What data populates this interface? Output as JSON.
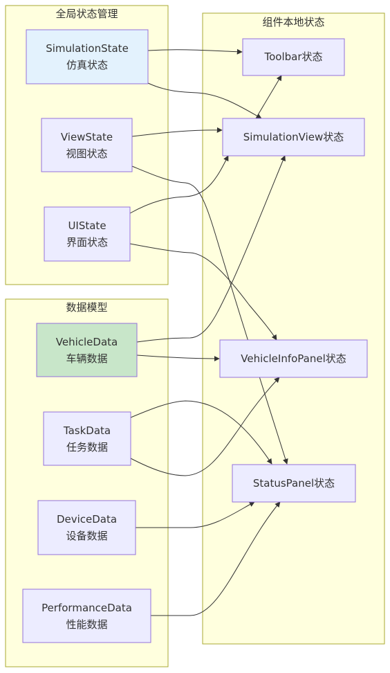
{
  "clusters": {
    "global": {
      "title": "全局状态管理"
    },
    "data": {
      "title": "数据模型"
    },
    "local": {
      "title": "组件本地状态"
    }
  },
  "nodes": {
    "simstate": {
      "line1": "SimulationState",
      "line2": "仿真状态",
      "fill": "#e3f2fd"
    },
    "viewstate": {
      "line1": "ViewState",
      "line2": "视图状态",
      "fill": "#ececff"
    },
    "uistate": {
      "line1": "UIState",
      "line2": "界面状态",
      "fill": "#ececff"
    },
    "vehicledata": {
      "line1": "VehicleData",
      "line2": "车辆数据",
      "fill": "#c8e6c9"
    },
    "taskdata": {
      "line1": "TaskData",
      "line2": "任务数据",
      "fill": "#ececff"
    },
    "devicedata": {
      "line1": "DeviceData",
      "line2": "设备数据",
      "fill": "#ececff"
    },
    "perfdata": {
      "line1": "PerformanceData",
      "line2": "性能数据",
      "fill": "#ececff"
    },
    "toolbar": {
      "line1": "Toolbar状态",
      "fill": "#ececff"
    },
    "simview": {
      "line1": "SimulationView状态",
      "fill": "#ececff"
    },
    "vehiclepanel": {
      "line1": "VehicleInfoPanel状态",
      "fill": "#ececff"
    },
    "statuspanel": {
      "line1": "StatusPanel状态",
      "fill": "#ececff"
    }
  },
  "edges": [
    {
      "from": "SimulationState",
      "to": "Toolbar状态"
    },
    {
      "from": "SimulationState",
      "to": "SimulationView状态"
    },
    {
      "from": "SimulationView状态",
      "to": "Toolbar状态"
    },
    {
      "from": "ViewState",
      "to": "SimulationView状态"
    },
    {
      "from": "ViewState",
      "to": "StatusPanel状态"
    },
    {
      "from": "UIState",
      "to": "SimulationView状态"
    },
    {
      "from": "UIState",
      "to": "VehicleInfoPanel状态"
    },
    {
      "from": "VehicleData",
      "to": "SimulationView状态"
    },
    {
      "from": "VehicleData",
      "to": "VehicleInfoPanel状态"
    },
    {
      "from": "TaskData",
      "to": "StatusPanel状态"
    },
    {
      "from": "TaskData",
      "to": "VehicleInfoPanel状态"
    },
    {
      "from": "DeviceData",
      "to": "StatusPanel状态"
    },
    {
      "from": "PerformanceData",
      "to": "StatusPanel状态"
    }
  ],
  "colors": {
    "cluster_fill": "#ffffde",
    "cluster_stroke": "#aaaa33",
    "node_stroke": "#9370db",
    "edge": "#333333"
  }
}
